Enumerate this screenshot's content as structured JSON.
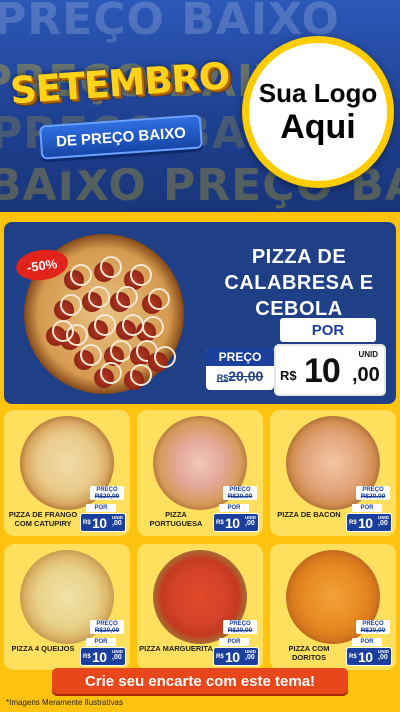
{
  "header": {
    "bg_words": [
      "PREÇO BAIXO",
      "PREÇO BAIXO",
      "PREÇO BAIXO",
      "BAIXO PREÇO BAIXO"
    ],
    "title_main": "SETEMBRO",
    "title_sub": "DE PREÇO BAIXO",
    "logo_line1": "Sua Logo",
    "logo_line2": "Aqui"
  },
  "featured": {
    "discount_badge": "-50%",
    "name": "PIZZA DE CALABRESA E CEBOLA",
    "old_label": "PREÇO",
    "old_price_currency": "R$",
    "old_price": "20,00",
    "new_label": "POR",
    "currency": "R$",
    "new_price_int": "10",
    "new_price_dec": ",00",
    "unit": "UNID"
  },
  "products": [
    {
      "name": "PIZZA DE FRANGO COM CATUPIRY",
      "old_label": "PREÇO",
      "old_price": "R$20,00",
      "new_label": "POR",
      "currency": "R$",
      "price_int": "10",
      "price_dec": ",00",
      "unit": "UNID"
    },
    {
      "name": "PIZZA PORTUGUESA",
      "old_label": "PREÇO",
      "old_price": "R$20,00",
      "new_label": "POR",
      "currency": "R$",
      "price_int": "10",
      "price_dec": ",00",
      "unit": "UNID"
    },
    {
      "name": "PIZZA DE BACON",
      "old_label": "PREÇO",
      "old_price": "R$20,00",
      "new_label": "POR",
      "currency": "R$",
      "price_int": "10",
      "price_dec": ",00",
      "unit": "UNID"
    },
    {
      "name": "PIZZA 4 QUEIJOS",
      "old_label": "PREÇO",
      "old_price": "R$20,00",
      "new_label": "POR",
      "currency": "R$",
      "price_int": "10",
      "price_dec": ",00",
      "unit": "UNID"
    },
    {
      "name": "PIZZA MARGUERITA",
      "old_label": "PREÇO",
      "old_price": "R$20,00",
      "new_label": "POR",
      "currency": "R$",
      "price_int": "10",
      "price_dec": ",00",
      "unit": "UNID"
    },
    {
      "name": "PIZZA COM DORITOS",
      "old_label": "PREÇO",
      "old_price": "R$20,00",
      "new_label": "POR",
      "currency": "R$",
      "price_int": "10",
      "price_dec": ",00",
      "unit": "UNID"
    }
  ],
  "cta_label": "Crie seu encarte com este tema!",
  "footnote": "*Imagens Meramente Ilustrativas",
  "colors": {
    "brand_blue": "#1f3f86",
    "brand_yellow": "#ffc20e",
    "cta_orange": "#e8471b",
    "badge_red": "#e2231a"
  }
}
